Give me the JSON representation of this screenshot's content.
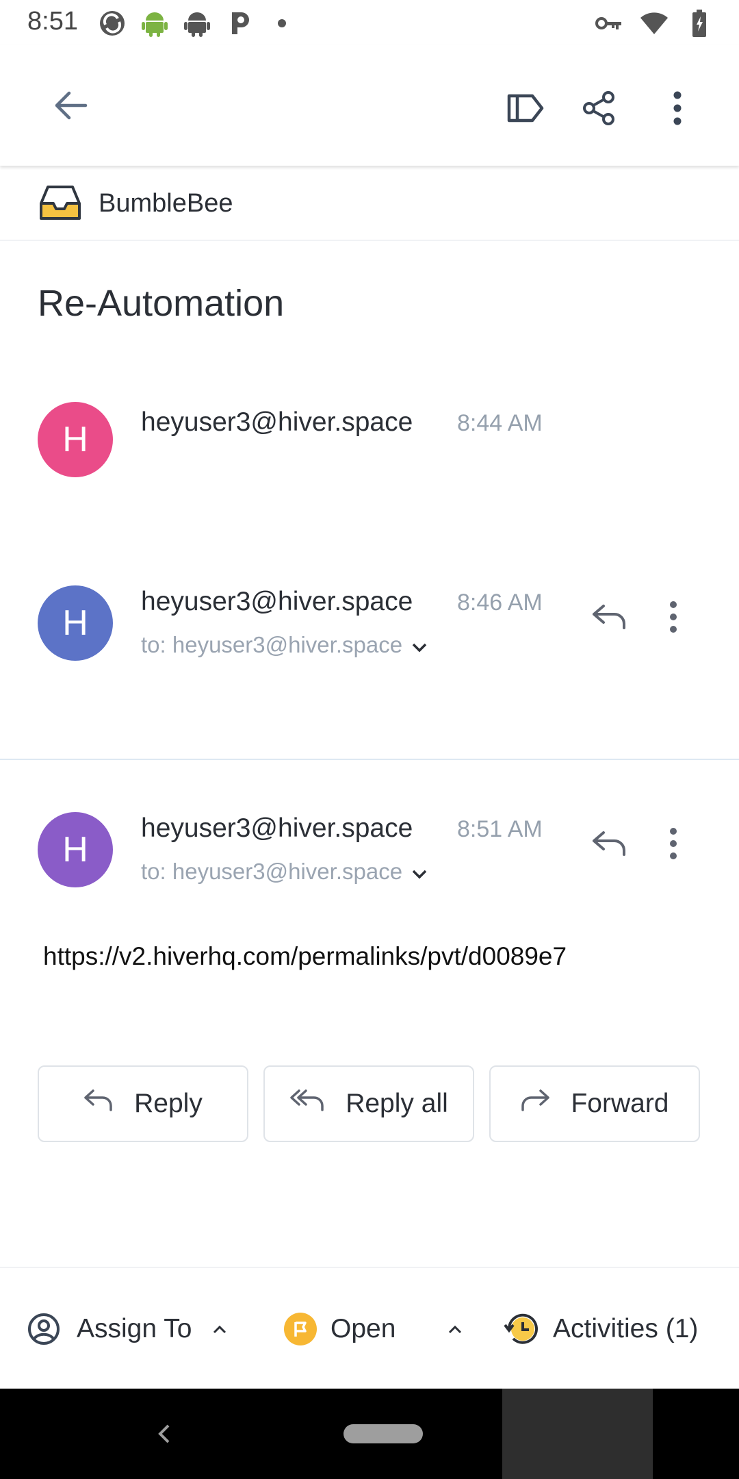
{
  "status_bar": {
    "time": "8:51",
    "left_icons": [
      "sync-icon",
      "android-icon",
      "android-outline-icon",
      "parking-icon",
      "dot-icon"
    ],
    "right_icons": [
      "vpn-key-icon",
      "wifi-icon",
      "battery-charging-icon"
    ]
  },
  "app_bar": {
    "icons": [
      "back-arrow-icon",
      "label-icon",
      "share-icon",
      "more-vertical-icon"
    ]
  },
  "inbox": {
    "name": "BumbleBee",
    "icon": "inbox-tray-icon",
    "icon_color": "#f5c241"
  },
  "subject": "Re-Automation",
  "messages": [
    {
      "avatar_letter": "H",
      "avatar_color": "#ea4c89",
      "sender": "heyuser3@hiver.space",
      "time": "8:44 AM"
    },
    {
      "avatar_letter": "H",
      "avatar_color": "#5c73c7",
      "sender": "heyuser3@hiver.space",
      "time": "8:46 AM",
      "recipient": "to: heyuser3@hiver.space"
    },
    {
      "avatar_letter": "H",
      "avatar_color": "#8a5cc8",
      "sender": "heyuser3@hiver.space",
      "time": "8:51 AM",
      "recipient": "to: heyuser3@hiver.space",
      "body": "https://v2.hiverhq.com/permalinks/pvt/d0089e7"
    }
  ],
  "actions": {
    "reply": "Reply",
    "reply_all": "Reply all",
    "forward": "Forward"
  },
  "bottom_bar": {
    "assign_label": "Assign To",
    "status_label": "Open",
    "status_color": "#f7b733",
    "activities_label": "Activities (1)"
  }
}
